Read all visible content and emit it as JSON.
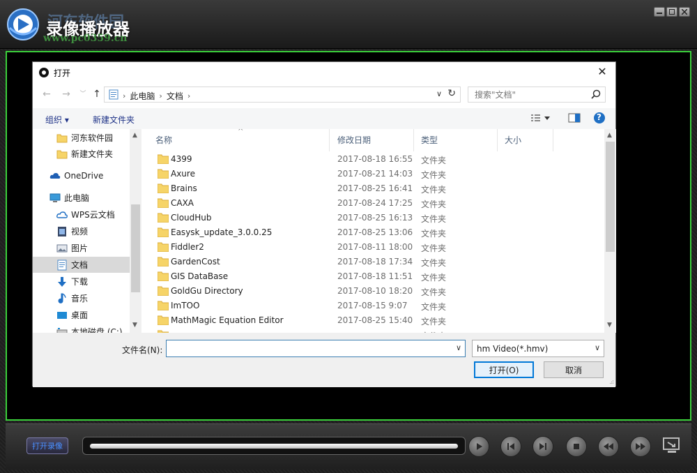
{
  "app": {
    "title": "录像播放器",
    "watermark_text": "河东软件园",
    "watermark_url": "www.pc0359.cn",
    "open_record_label": "打开录像",
    "accent_color": "#3bd13b"
  },
  "dialog": {
    "title": "打开",
    "close_glyph": "✕",
    "nav": {
      "back": "←",
      "forward": "→",
      "recent": "﹀",
      "up": "↑"
    },
    "address": {
      "segments": [
        "此电脑",
        "文档"
      ],
      "sep": "›",
      "trail_sep": "›",
      "dropdown": "∨",
      "refresh": "↻"
    },
    "search": {
      "placeholder": "搜索\"文档\""
    },
    "toolbar": {
      "organize": "组织 ▾",
      "new_folder": "新建文件夹",
      "help": "?"
    },
    "nav_pane": [
      {
        "label": "河东软件园",
        "icon": "folder-icon",
        "indent": 1
      },
      {
        "label": "新建文件夹",
        "icon": "folder-icon",
        "indent": 1
      },
      {
        "label": "OneDrive",
        "icon": "cloud-icon",
        "indent": 0
      },
      {
        "label": "此电脑",
        "icon": "computer-icon",
        "indent": 0
      },
      {
        "label": "WPS云文档",
        "icon": "wps-cloud-icon",
        "indent": 1
      },
      {
        "label": "视频",
        "icon": "video-icon",
        "indent": 1
      },
      {
        "label": "图片",
        "icon": "picture-icon",
        "indent": 1
      },
      {
        "label": "文档",
        "icon": "document-icon",
        "indent": 1,
        "selected": true
      },
      {
        "label": "下载",
        "icon": "download-icon",
        "indent": 1
      },
      {
        "label": "音乐",
        "icon": "music-icon",
        "indent": 1
      },
      {
        "label": "桌面",
        "icon": "desktop-icon",
        "indent": 1
      },
      {
        "label": "本地磁盘 (C:)",
        "icon": "drive-icon",
        "indent": 1
      }
    ],
    "columns": {
      "name": "名称",
      "date": "修改日期",
      "type": "类型",
      "size": "大小",
      "sort_arrow": "^"
    },
    "files": [
      {
        "name": "4399",
        "date": "2017-08-18 16:55",
        "type": "文件夹"
      },
      {
        "name": "Axure",
        "date": "2017-08-21 14:03",
        "type": "文件夹"
      },
      {
        "name": "Brains",
        "date": "2017-08-25 16:41",
        "type": "文件夹"
      },
      {
        "name": "CAXA",
        "date": "2017-08-24 17:25",
        "type": "文件夹"
      },
      {
        "name": "CloudHub",
        "date": "2017-08-25 16:13",
        "type": "文件夹"
      },
      {
        "name": "Easysk_update_3.0.0.25",
        "date": "2017-08-25 13:06",
        "type": "文件夹"
      },
      {
        "name": "Fiddler2",
        "date": "2017-08-11 18:00",
        "type": "文件夹"
      },
      {
        "name": "GardenCost",
        "date": "2017-08-18 17:34",
        "type": "文件夹"
      },
      {
        "name": "GIS DataBase",
        "date": "2017-08-18 11:51",
        "type": "文件夹"
      },
      {
        "name": "GoldGu Directory",
        "date": "2017-08-10 18:20",
        "type": "文件夹"
      },
      {
        "name": "ImTOO",
        "date": "2017-08-15 9:07",
        "type": "文件夹"
      },
      {
        "name": "MathMagic Equation Editor",
        "date": "2017-08-25 15:40",
        "type": "文件夹"
      },
      {
        "name": "",
        "date": "",
        "type": "文件夹"
      }
    ],
    "footer": {
      "filename_label": "文件名(N):",
      "filename_value": "",
      "filter_value": "hm Video(*.hmv)",
      "open_label": "打开(O)",
      "cancel_label": "取消"
    }
  }
}
